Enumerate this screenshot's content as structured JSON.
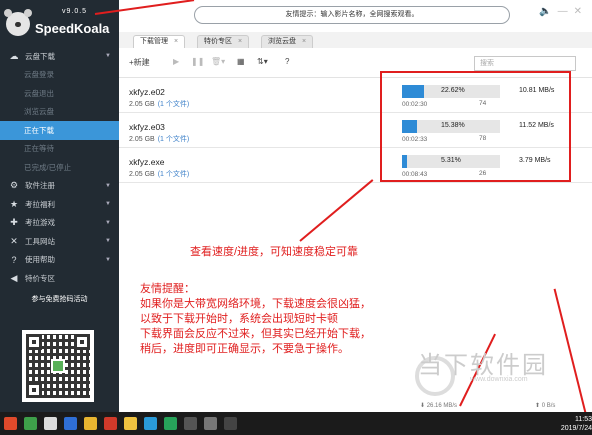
{
  "app": {
    "version": "v9.0.5",
    "name": "SpeedKoala"
  },
  "sidebar": {
    "items": [
      {
        "label": "云盘下载",
        "icon": "cloud-icon",
        "arrow": true
      },
      {
        "label": "云盘登录",
        "sub": true
      },
      {
        "label": "云盘退出",
        "sub": true
      },
      {
        "label": "浏览云盘",
        "sub": true
      },
      {
        "label": "正在下载",
        "sub": true,
        "active": true
      },
      {
        "label": "正在等待",
        "sub": true
      },
      {
        "label": "已完成/已停止",
        "sub": true
      },
      {
        "label": "软件注册",
        "icon": "gear-icon",
        "arrow": true
      },
      {
        "label": "考拉福利",
        "icon": "gift-icon",
        "arrow": true
      },
      {
        "label": "考拉游戏",
        "icon": "gamepad-icon",
        "arrow": true
      },
      {
        "label": "工具网站",
        "icon": "tools-icon",
        "arrow": true
      },
      {
        "label": "使用帮助",
        "icon": "help-icon",
        "arrow": true
      },
      {
        "label": "特价专区",
        "icon": "megaphone-icon",
        "arrow": false
      }
    ],
    "promo": "参与免费抢码活动"
  },
  "topbar": {
    "notice": "友情提示：输入影片名称，全网搜索观看。"
  },
  "tabs": [
    {
      "label": "下载管理",
      "active": true
    },
    {
      "label": "特价专区",
      "active": false
    },
    {
      "label": "浏览云盘",
      "active": false
    }
  ],
  "toolbar": {
    "new_label": "+新建",
    "search_placeholder": "搜索"
  },
  "downloads": [
    {
      "name": "xkfyz.e02",
      "size": "2.05 GB",
      "files": "(1 个文件)",
      "progress": 22.62,
      "percent": "22.62%",
      "elapsed": "00:02:30",
      "count": "74",
      "speed": "10.81 MB/s"
    },
    {
      "name": "xkfyz.e03",
      "size": "2.05 GB",
      "files": "(1 个文件)",
      "progress": 15.38,
      "percent": "15.38%",
      "elapsed": "00:02:33",
      "count": "78",
      "speed": "11.52 MB/s"
    },
    {
      "name": "xkfyz.exe",
      "size": "2.05 GB",
      "files": "(1 个文件)",
      "progress": 5.31,
      "percent": "5.31%",
      "elapsed": "00:08:43",
      "count": "26",
      "speed": "3.79 MB/s"
    }
  ],
  "annotations": {
    "speed_note": "查看速度/进度，可知速度稳定可靠",
    "tip": "友情提醒：\n如果你是大带宽网络环境，下载速度会很凶猛，\n以致于下载开始时，系统会出现短时卡顿\n下载界面会反应不过来，但其实已经开始下载，\n稍后，进度即可正确显示，不要急于操作。"
  },
  "watermark": {
    "text": "当下软件园",
    "url": "www.downxia.com"
  },
  "status": {
    "down": "26.16 MB/s",
    "up": "0 B/s"
  },
  "clock": {
    "time": "11:53",
    "date": "2019/7/24"
  },
  "colors": {
    "accent": "#3b96d9",
    "annotation": "#e01e1e",
    "sidebar": "#222b33",
    "progress": "#2e8bd6"
  }
}
